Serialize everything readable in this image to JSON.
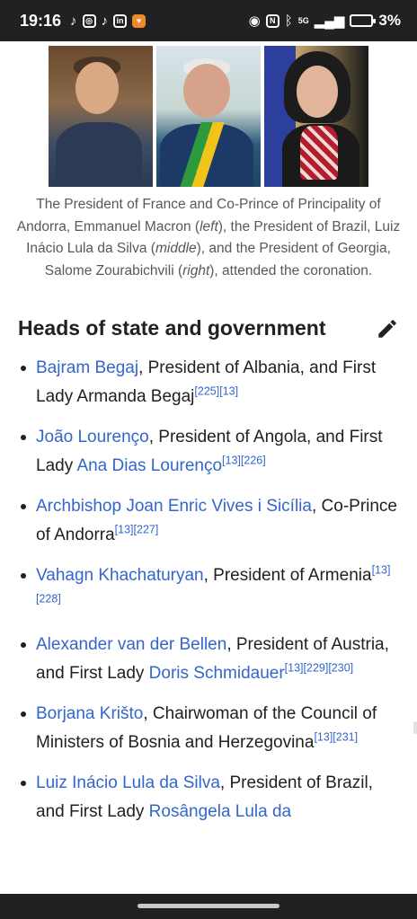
{
  "status_bar": {
    "time": "19:16",
    "left_icons": [
      "tiktok-icon",
      "instagram-icon",
      "tiktok-icon",
      "linkedin-icon",
      "notification-app-icon"
    ],
    "right_icons": [
      "eye-icon",
      "nfc-icon",
      "bluetooth-icon",
      "signal-5g-icon",
      "battery-saver-icon"
    ],
    "signal_label": "5G",
    "battery_percent": "3%"
  },
  "figure": {
    "images": [
      {
        "subject": "Emmanuel Macron"
      },
      {
        "subject": "Luiz Inácio Lula da Silva"
      },
      {
        "subject": "Salome Zourabichvili"
      }
    ],
    "caption": {
      "part1": "The President of France and Co-Prince of Principality of Andorra, Emmanuel Macron (",
      "left": "left",
      "part2": "), the President of Brazil, Luiz Inácio Lula da Silva (",
      "middle": "middle",
      "part3": "), and the President of Georgia, Salome Zourabichvili (",
      "right": "right",
      "part4": "), attended the coronation."
    }
  },
  "section": {
    "title": "Heads of state and government",
    "edit_icon": "pencil-icon"
  },
  "items": [
    {
      "link1": "Bajram Begaj",
      "text1": ", President of Albania, and First Lady Armanda Begaj",
      "refs": "[225][13]"
    },
    {
      "link1": "João Lourenço",
      "text1": ", President of Angola, and First Lady ",
      "link2": "Ana Dias Lourenço",
      "refs": "[13][226]"
    },
    {
      "link1": "Archbishop Joan Enric Vives i Sicília",
      "text1": ", Co-Prince of Andorra",
      "refs": "[13][227]"
    },
    {
      "link1": "Vahagn Khachaturyan",
      "text1": ", President of Armenia",
      "refs": "[13][228]"
    },
    {
      "link1": "Alexander van der Bellen",
      "text1": ", President of Austria, and First Lady ",
      "link2": "Doris Schmidauer",
      "refs": "[13][229][230]"
    },
    {
      "link1": "Borjana Krišto",
      "text1": ", Chairwoman of the Council of Ministers of Bosnia and Herzegovina",
      "refs": "[13][231]"
    },
    {
      "link1": "Luiz Inácio Lula da Silva",
      "text1": ", President of Brazil, and First Lady ",
      "link2": "Rosângela Lula da"
    }
  ],
  "colors": {
    "link": "#3366cc",
    "text": "#202122",
    "caption": "#54595d",
    "bars": "#202122"
  }
}
